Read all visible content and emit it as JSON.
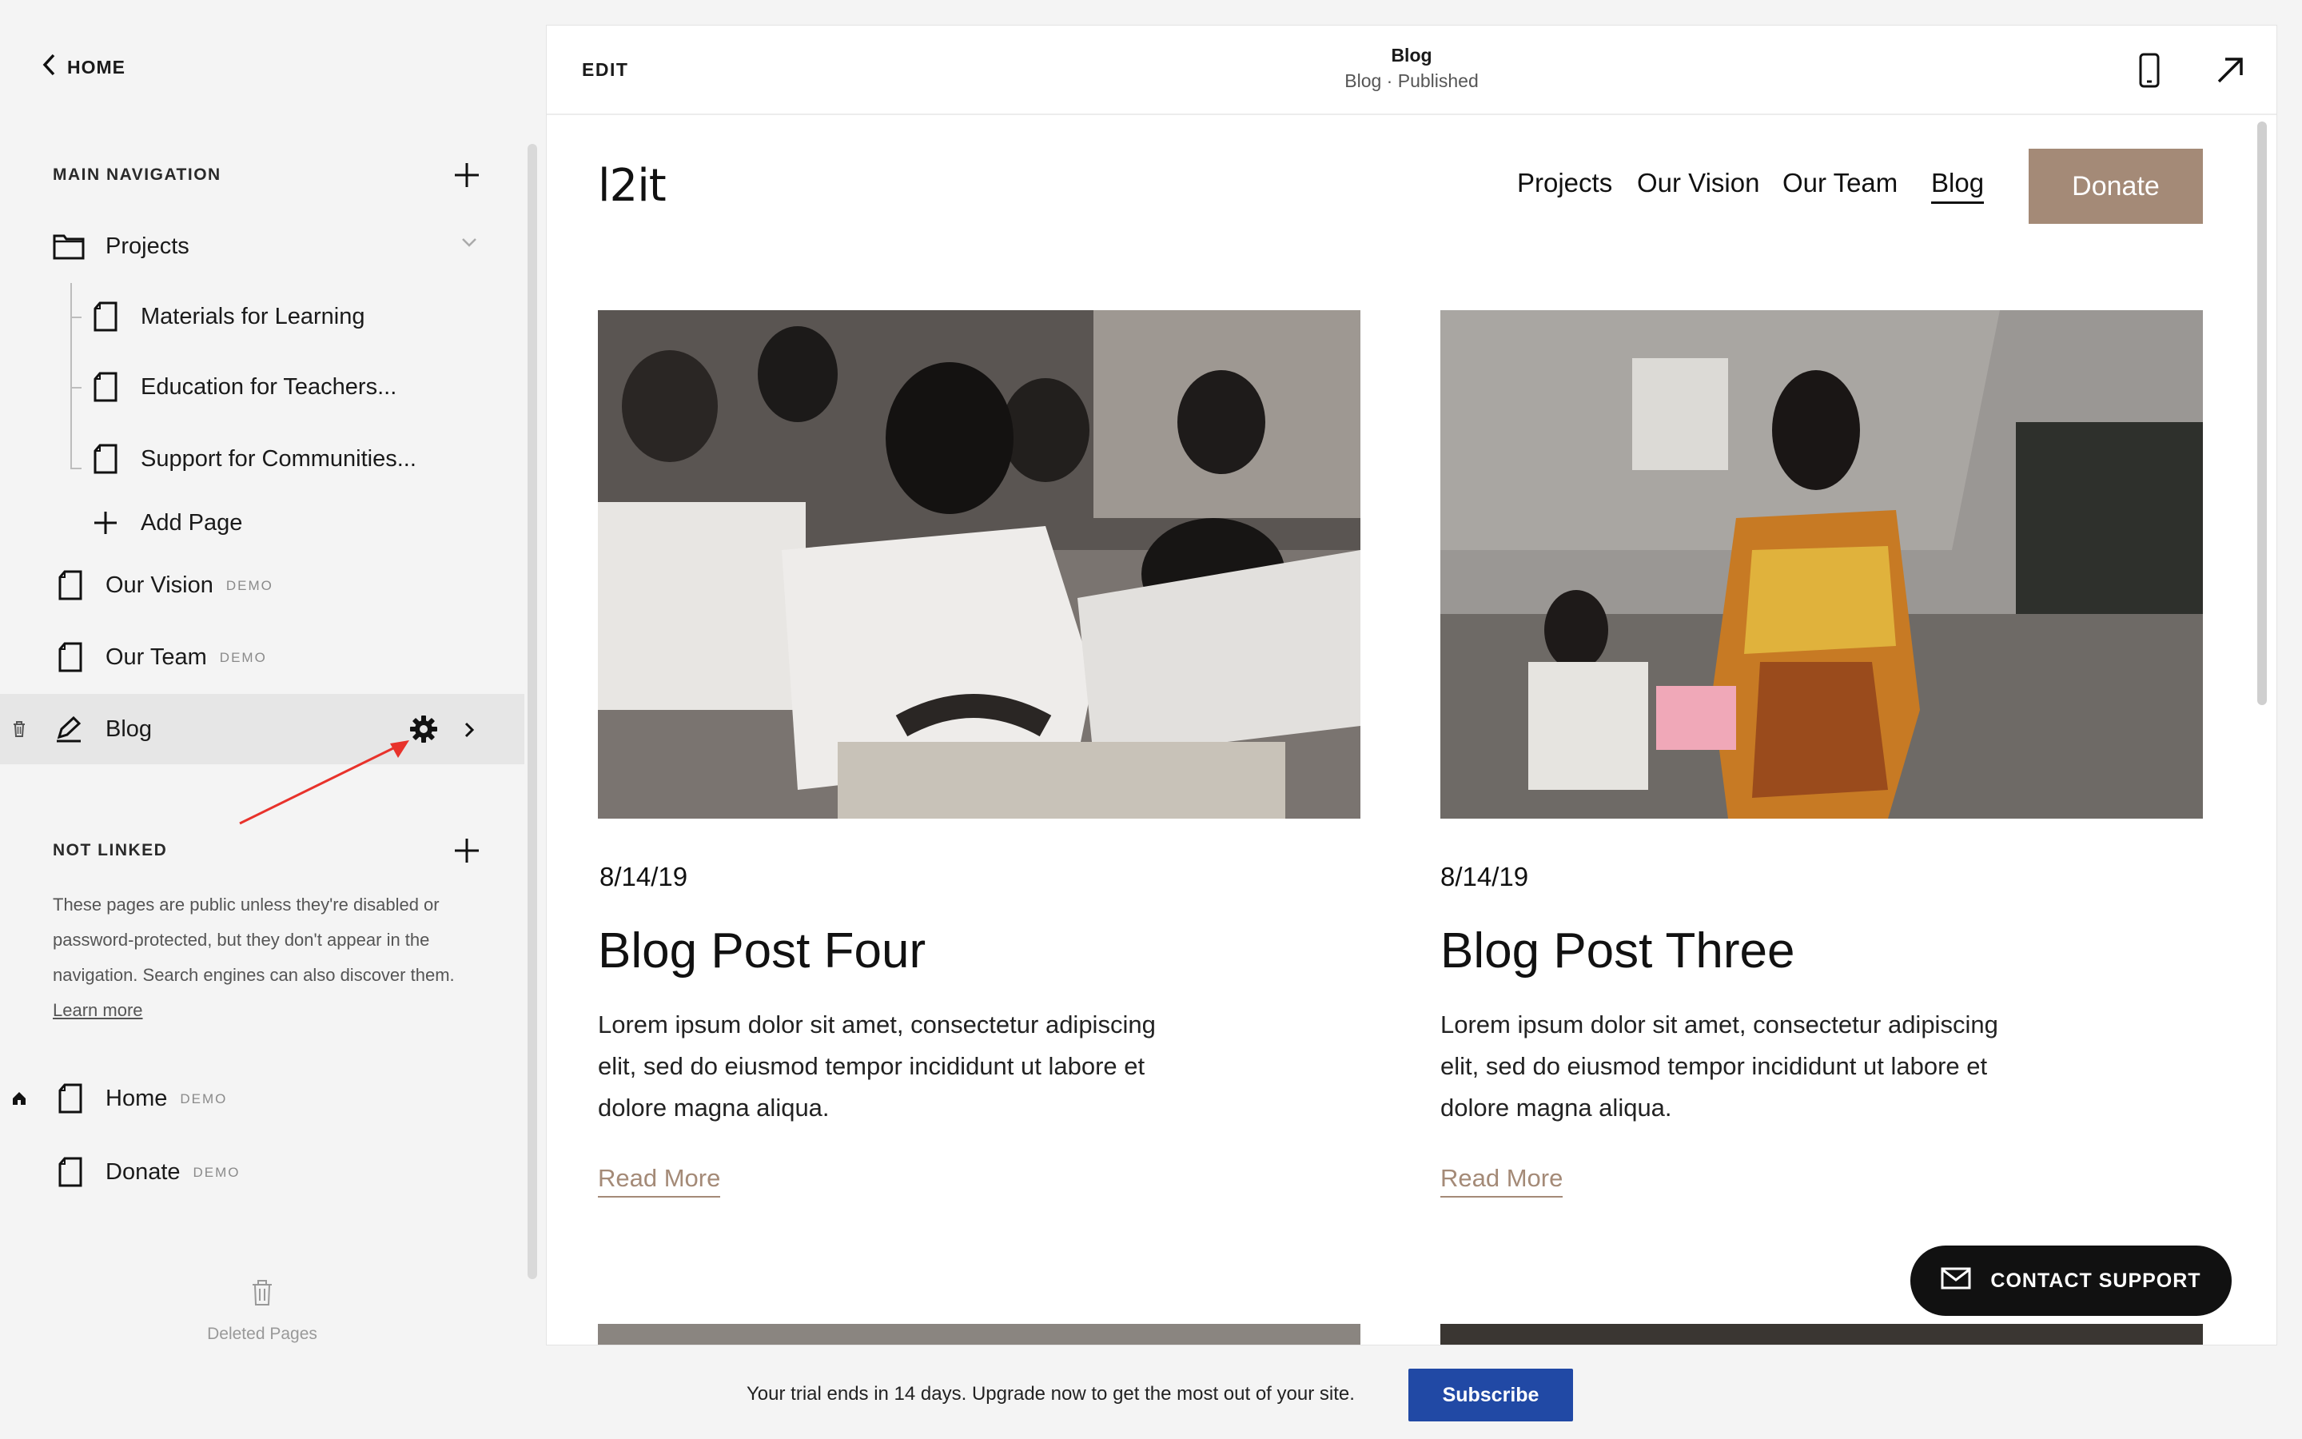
{
  "sidebar": {
    "home_label": "HOME",
    "main_navigation": {
      "heading": "MAIN NAVIGATION",
      "items": [
        {
          "label": "Projects",
          "icon": "folder-icon"
        },
        {
          "label": "Materials for Learning",
          "icon": "page-icon"
        },
        {
          "label": "Education for Teachers...",
          "icon": "page-icon"
        },
        {
          "label": "Support for Communities...",
          "icon": "page-icon"
        },
        {
          "label": "Add Page",
          "icon": "plus-icon"
        },
        {
          "label": "Our Vision",
          "badge": "DEMO",
          "icon": "page-icon"
        },
        {
          "label": "Our Team",
          "badge": "DEMO",
          "icon": "page-icon"
        },
        {
          "label": "Blog",
          "icon": "blog-icon",
          "active": true
        }
      ]
    },
    "not_linked": {
      "heading": "NOT LINKED",
      "description": "These pages are public unless they're disabled or password-protected, but they don't appear in the navigation. Search engines can also discover them.",
      "learn_more": "Learn more",
      "items": [
        {
          "label": "Home",
          "badge": "DEMO",
          "icon": "page-icon"
        },
        {
          "label": "Donate",
          "badge": "DEMO",
          "icon": "page-icon"
        }
      ]
    },
    "deleted_pages_label": "Deleted Pages"
  },
  "editor": {
    "edit_label": "EDIT",
    "page_title": "Blog",
    "page_status": "Blog · Published"
  },
  "site": {
    "logo": "l2it",
    "nav": [
      "Projects",
      "Our Vision",
      "Our Team",
      "Blog"
    ],
    "current_nav": "Blog",
    "donate_label": "Donate",
    "posts": [
      {
        "date": "8/14/19",
        "title": "Blog Post Four",
        "excerpt": "Lorem ipsum dolor sit amet, consectetur adipiscing elit, sed do eiusmod tempor incididunt ut labore et dolore magna aliqua.",
        "read_more": "Read More"
      },
      {
        "date": "8/14/19",
        "title": "Blog Post Three",
        "excerpt": "Lorem ipsum dolor sit amet, consectetur adipiscing elit, sed do eiusmod tempor incididunt ut labore et dolore magna aliqua.",
        "read_more": "Read More"
      }
    ]
  },
  "contact_support_label": "CONTACT SUPPORT",
  "trial": {
    "message": "Your trial ends in 14 days. Upgrade now to get the most out of your site.",
    "subscribe_label": "Subscribe"
  },
  "colors": {
    "accent_brown": "#a48a77",
    "subscribe_blue": "#2149a5",
    "annotation_red": "#e8322b"
  }
}
